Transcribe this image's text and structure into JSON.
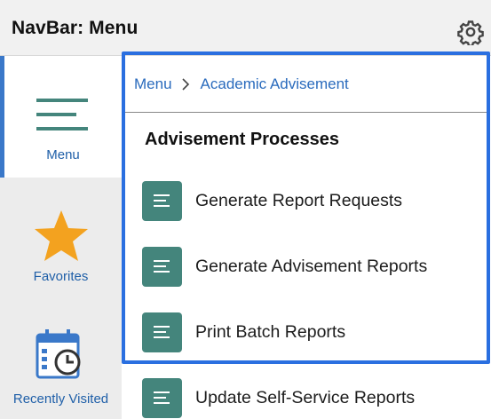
{
  "header": {
    "title": "NavBar: Menu",
    "settings_icon": "gear-icon"
  },
  "sidebar": {
    "items": [
      {
        "label": "Menu",
        "icon": "hamburger-menu-icon",
        "active": true
      },
      {
        "label": "Favorites",
        "icon": "star-icon",
        "active": false
      },
      {
        "label": "Recently Visited",
        "icon": "calendar-clock-icon",
        "active": false
      }
    ]
  },
  "breadcrumb": {
    "root": "Menu",
    "current": "Academic Advisement"
  },
  "section": {
    "title": "Advisement Processes"
  },
  "processes": [
    {
      "label": "Generate Report Requests",
      "icon": "document-lines-icon"
    },
    {
      "label": "Generate Advisement Reports",
      "icon": "document-lines-icon"
    },
    {
      "label": "Print Batch Reports",
      "icon": "document-lines-icon"
    },
    {
      "label": "Update Self-Service Reports",
      "icon": "document-lines-icon"
    }
  ],
  "colors": {
    "accent": "#3a78c9",
    "highlight_border": "#2a6fe0",
    "tile_green": "#44857c",
    "star": "#f3a21f",
    "link": "#2a6bbd"
  }
}
